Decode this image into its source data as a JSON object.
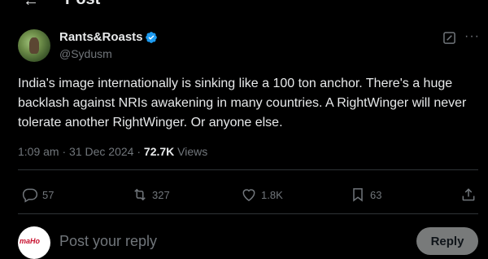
{
  "header": {
    "title": "Post",
    "back_icon": "arrow-left-icon"
  },
  "post": {
    "author": {
      "display_name": "Rants&Roasts",
      "handle": "@Sydusm",
      "verified": true
    },
    "text": "India's image internationally is sinking like a 100 ton anchor. There's a huge backlash against NRIs awakening in many countries. A RightWinger will never tolerate another RightWinger. Or anyone else.",
    "time": "1:09 am",
    "date": "31 Dec 2024",
    "separator": "·",
    "views_count": "72.7K",
    "views_label": "Views",
    "actions": {
      "replies": "57",
      "reposts": "327",
      "likes": "1.8K",
      "bookmarks": "63"
    }
  },
  "reply_box": {
    "placeholder": "Post your reply",
    "button_label": "Reply",
    "avatar_text": "maHo"
  },
  "colors": {
    "background": "#000000",
    "text": "#e7e9ea",
    "muted": "#71767b",
    "verified": "#1d9bf0",
    "divider": "#2f3336"
  }
}
